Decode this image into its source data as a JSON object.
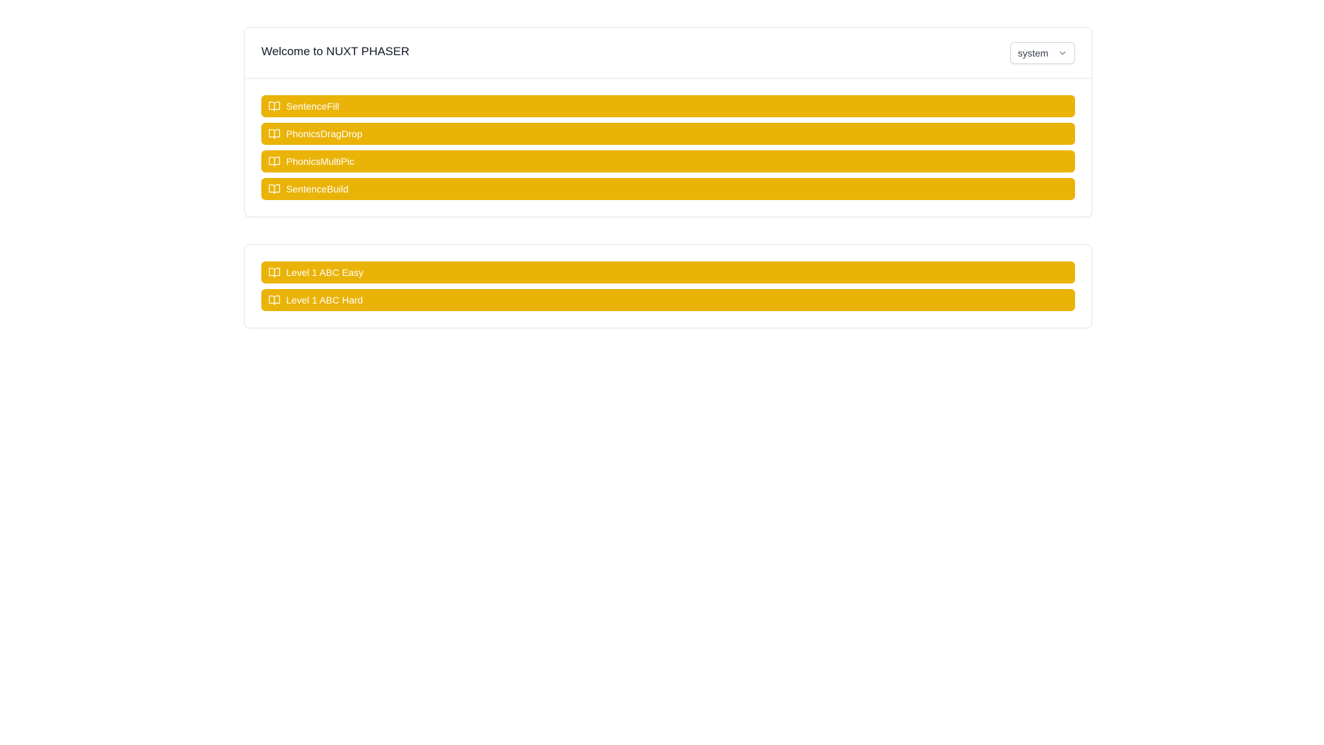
{
  "header": {
    "title": "Welcome to NUXT PHASER",
    "theme_select": {
      "value": "system",
      "icon": "chevron-down-icon"
    }
  },
  "games": {
    "items": [
      {
        "label": "SentenceFill",
        "icon": "book-open-icon"
      },
      {
        "label": "PhonicsDragDrop",
        "icon": "book-open-icon"
      },
      {
        "label": "PhonicsMultiPic",
        "icon": "book-open-icon"
      },
      {
        "label": "SentenceBuild",
        "icon": "book-open-icon"
      }
    ]
  },
  "levels": {
    "items": [
      {
        "label": "Level 1 ABC Easy",
        "icon": "book-open-icon"
      },
      {
        "label": "Level 1 ABC Hard",
        "icon": "book-open-icon"
      }
    ]
  },
  "colors": {
    "accent": "#eab308",
    "button_text": "#ffffff",
    "border": "#e5e7eb"
  }
}
